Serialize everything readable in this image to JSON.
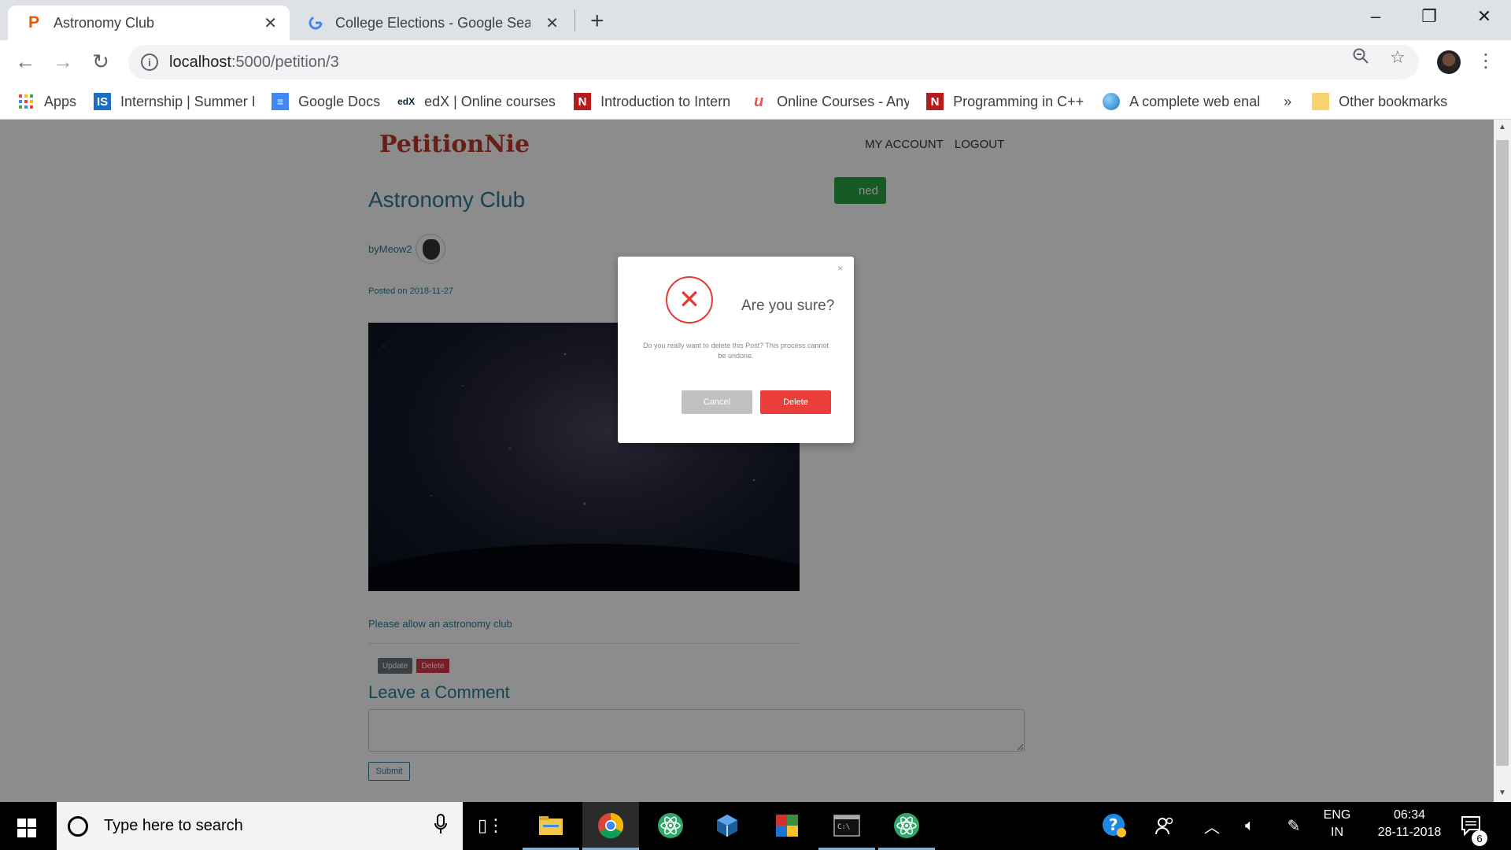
{
  "browser": {
    "tabs": [
      {
        "title": "Astronomy Club",
        "favicon": "petitionie-p-icon",
        "active": true
      },
      {
        "title": "College Elections - Google Search",
        "favicon": "google-g-icon",
        "active": false
      }
    ],
    "new_tab": "+",
    "window_controls": {
      "minimize": "–",
      "restore": "❐",
      "close": "✕"
    },
    "url_host": "localhost",
    "url_path": ":5000/petition/3",
    "bookmarks": [
      {
        "label": "Apps",
        "icon": "apps-grid-icon"
      },
      {
        "label": "Internship | Summer I",
        "icon": "internshala-icon"
      },
      {
        "label": "Google Docs",
        "icon": "google-docs-icon"
      },
      {
        "label": "edX | Online courses",
        "icon": "edx-icon"
      },
      {
        "label": "Introduction to Intern",
        "icon": "n-bookmark-icon"
      },
      {
        "label": "Online Courses - Any",
        "icon": "udemy-icon"
      },
      {
        "label": "Programming in C++",
        "icon": "n-bookmark-icon"
      },
      {
        "label": "A complete web enal",
        "icon": "globe-icon"
      }
    ],
    "more_bookmarks": "»",
    "other_bookmarks": "Other bookmarks"
  },
  "site": {
    "brand": "PetitionNie",
    "nav": [
      "MY ACCOUNT",
      "LOGOUT"
    ],
    "green_button": "ned",
    "post": {
      "title": "Astronomy Club",
      "author_prefix": "by ",
      "author": "Meow2",
      "posted": "Posted on 2018-11-27",
      "description": "Please allow an astronomy club",
      "update_label": "Update",
      "delete_label": "Delete"
    },
    "comment": {
      "heading": "Leave a Comment",
      "placeholder": "",
      "submit_label": "Submit"
    }
  },
  "modal": {
    "close": "×",
    "icon": "✕",
    "heading": "Are you sure?",
    "message": "Do you really want to delete this Post? This process cannot be undone.",
    "cancel_label": "Cancel",
    "delete_label": "Delete",
    "accent": "#e93e3a"
  },
  "taskbar": {
    "search_placeholder": "Type here to search",
    "language_top": "ENG",
    "language_bottom": "IN",
    "time": "06:34",
    "date": "28-11-2018",
    "notification_count": "6"
  }
}
